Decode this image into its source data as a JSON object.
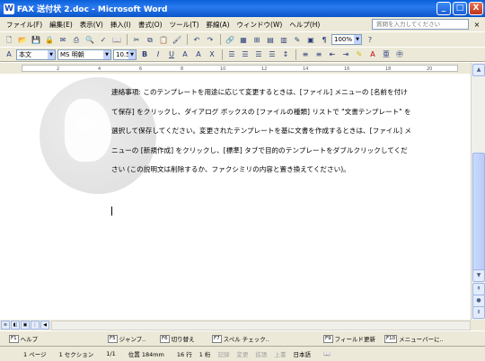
{
  "window": {
    "title": "FAX 送付状 2.doc - Microsoft Word",
    "app_icon": "W",
    "minimize": "_",
    "maximize": "□",
    "close": "X"
  },
  "menubar": {
    "items": [
      "ファイル(F)",
      "編集(E)",
      "表示(V)",
      "挿入(I)",
      "書式(O)",
      "ツール(T)",
      "罫線(A)",
      "ウィンドウ(W)",
      "ヘルプ(H)"
    ],
    "help_placeholder": "質問を入力してください",
    "doc_close": "×"
  },
  "toolbar": {
    "zoom": "100%",
    "style": "本文",
    "font": "MS 明朝",
    "size": "10.5"
  },
  "ruler": {
    "ticks": [
      "2",
      "4",
      "6",
      "8",
      "10",
      "12",
      "14",
      "16",
      "18",
      "20"
    ]
  },
  "document": {
    "paragraph": "連絡事項: このテンプレートを用途に応じて変更するときは、[ファイル] メニューの [名前を付けて保存] をクリックし、ダイアログ ボックスの [ファイルの種類] リストで \"文書テンプレート\" を選択して保存してください。変更されたテンプレートを基に文書を作成するときは、[ファイル] メニューの [新規作成] をクリックし、[標準] タブで目的のテンプレートをダブルクリックしてください (この説明文は削除するか、ファクシミリの内容と置き換えてください)。"
  },
  "fkeys": [
    {
      "key": "F1",
      "label": "ヘルプ",
      "enabled": true
    },
    {
      "key": "F5",
      "label": "ジャンプ..",
      "enabled": true
    },
    {
      "key": "F6",
      "label": "切り替え",
      "enabled": true
    },
    {
      "key": "F7",
      "label": "スペル チェック..",
      "enabled": true
    },
    {
      "key": "F9",
      "label": "フィールド更新",
      "enabled": true
    },
    {
      "key": "F10",
      "label": "メニューバーに..",
      "enabled": true
    }
  ],
  "statusbar": {
    "page": "1 ページ",
    "section": "1 セクション",
    "pages": "1/1",
    "position": "位置 184mm",
    "line": "16 行",
    "column": "1 桁",
    "rec": "記録",
    "trk": "変更",
    "ext": "拡張",
    "ovr": "上書",
    "language": "日本語"
  },
  "colors": {
    "titlebar": "#0a5fd8",
    "chrome": "#ece9d8",
    "close_button": "#c2351a"
  }
}
